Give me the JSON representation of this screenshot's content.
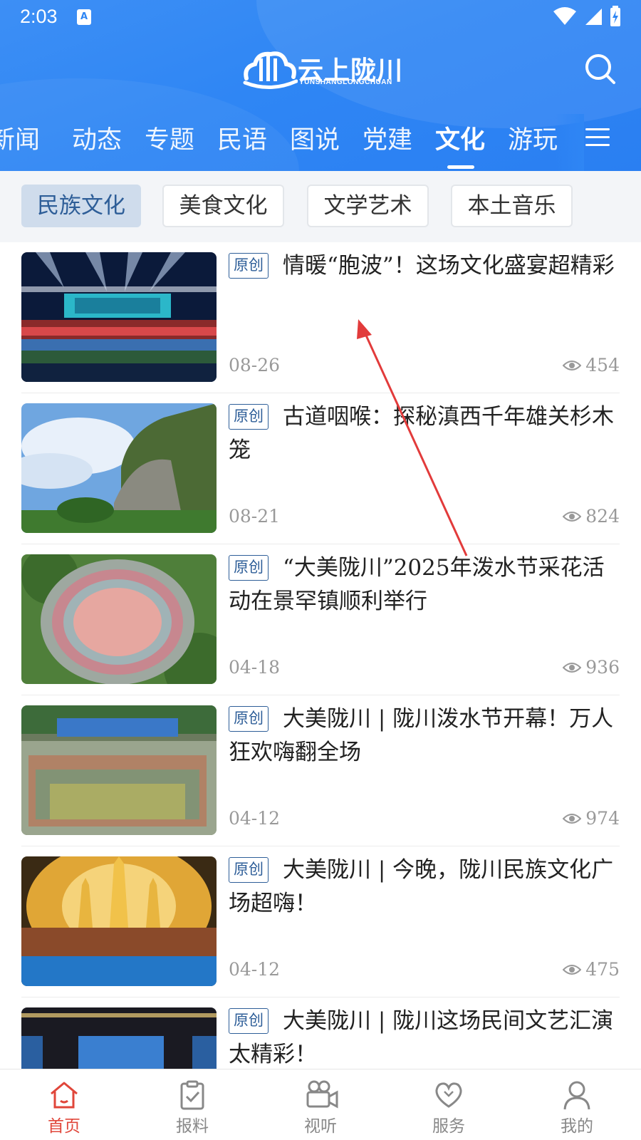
{
  "status_bar": {
    "time": "2:03",
    "badge": "A"
  },
  "header": {
    "logo_title": "云上陇川",
    "logo_subtitle": "YUNSHANGLONGCHUAN",
    "icons": [
      "search-icon",
      "menu-icon"
    ],
    "colors": {
      "background": "#2f86f4",
      "text": "#ffffff"
    }
  },
  "channel_tabs": [
    {
      "label": "新闻",
      "active": false
    },
    {
      "label": "动态",
      "active": false
    },
    {
      "label": "专题",
      "active": false
    },
    {
      "label": "民语",
      "active": false
    },
    {
      "label": "图说",
      "active": false
    },
    {
      "label": "党建",
      "active": false
    },
    {
      "label": "文化",
      "active": true
    },
    {
      "label": "游玩",
      "active": false
    }
  ],
  "subcategories": [
    {
      "label": "民族文化",
      "active": true
    },
    {
      "label": "美食文化",
      "active": false
    },
    {
      "label": "文学艺术",
      "active": false
    },
    {
      "label": "本土音乐",
      "active": false
    }
  ],
  "news": [
    {
      "tag": "原创",
      "title": "情暖“胞波”！这场文化盛宴超精彩",
      "date": "08-26",
      "views": "454",
      "thumb": "stage-performance"
    },
    {
      "tag": "原创",
      "title": "古道咽喉：探秘滇西千年雄关杉木笼",
      "date": "08-21",
      "views": "824",
      "thumb": "cliff-landscape"
    },
    {
      "tag": "原创",
      "title": "“大美陇川”2025年泼水节采花活动在景罕镇顺利举行",
      "date": "04-18",
      "views": "936",
      "thumb": "aerial-crowd-circle"
    },
    {
      "tag": "原创",
      "title": "大美陇川 | 陇川泼水节开幕！万人狂欢嗨翻全场",
      "date": "04-12",
      "views": "974",
      "thumb": "festival-crowd"
    },
    {
      "tag": "原创",
      "title": "大美陇川 | 今晚，陇川民族文化广场超嗨！",
      "date": "04-12",
      "views": "475",
      "thumb": "golden-pagoda-stage"
    },
    {
      "tag": "原创",
      "title": "大美陇川 | 陇川这场民间文艺汇演太精彩！",
      "date": "",
      "views": "",
      "thumb": "night-stage"
    }
  ],
  "bottom_nav": [
    {
      "label": "首页",
      "icon": "home-icon",
      "active": true
    },
    {
      "label": "报料",
      "icon": "report-icon",
      "active": false
    },
    {
      "label": "视听",
      "icon": "video-camera-icon",
      "active": false
    },
    {
      "label": "服务",
      "icon": "heart-icon",
      "active": false
    },
    {
      "label": "我的",
      "icon": "user-icon",
      "active": false
    }
  ],
  "colors": {
    "accent": "#2e5e98",
    "nav_active": "#e0463a",
    "meta_text": "#999999"
  }
}
